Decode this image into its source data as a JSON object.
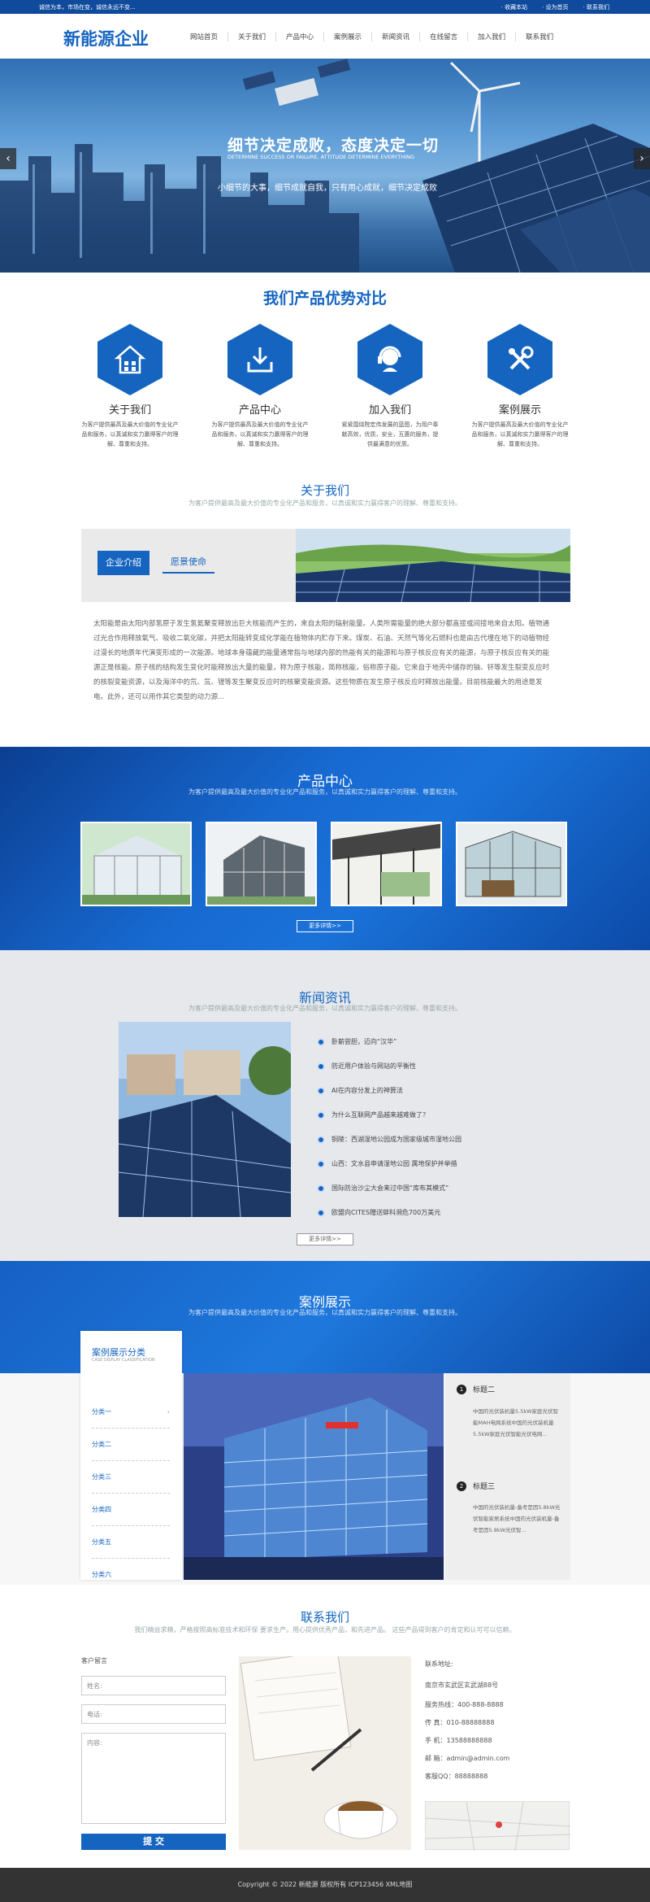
{
  "topbar": {
    "slogan": "诚信为本，市场在变，诚信永远不变...",
    "links": [
      "· 收藏本站",
      "· 设为首页",
      "· 联系我们"
    ]
  },
  "header": {
    "logo": "新能源企业",
    "nav": [
      "网站首页",
      "关于我们",
      "产品中心",
      "案例展示",
      "新闻资讯",
      "在线留言",
      "加入我们",
      "联系我们"
    ]
  },
  "banner": {
    "headline": "细节决定成败，态度决定一切",
    "sub": "DETERMINE SUCCESS OR FAILURE, ATTITUDE DETERMINE EVERYTHING",
    "tagline": "小细节的大事，细节成就自我，只有用心成就，细节决定成败",
    "prev_icon": "chevron-left-icon",
    "next_icon": "chevron-right-icon"
  },
  "advantages": {
    "title": "我们产品优势对比",
    "items": [
      {
        "icon": "building-icon",
        "title": "关于我们",
        "desc": "为客户提供最高及最大价值的专业化产品和服务，以真诚和实力赢得客户的理解、尊重和支持。"
      },
      {
        "icon": "download-icon",
        "title": "产品中心",
        "desc": "为客户提供最高及最大价值的专业化产品和服务，以真诚和实力赢得客户的理解、尊重和支持。"
      },
      {
        "icon": "headset-icon",
        "title": "加入我们",
        "desc": "紧紧围绕院宏伟发展的蓝图，为用户奉献高效，优质，安全，互惠的服务，提供最满意的优质。"
      },
      {
        "icon": "tools-icon",
        "title": "案例展示",
        "desc": "为客户提供最高及最大价值的专业化产品和服务，以真诚和实力赢得客户的理解、尊重和支持。"
      }
    ]
  },
  "about": {
    "title": "关于我们",
    "sub": "为客户提供最高及最大价值的专业化产品和服务，以真诚和实力赢得客户的理解、尊重和支持。",
    "tabs": [
      "企业介绍",
      "愿景使命"
    ],
    "text": "太阳能是由太阳内部氢原子发生氢氦聚变释放出巨大核能而产生的，来自太阳的辐射能量。人类所需能量的绝大部分都直接或间接地来自太阳。植物通过光合作用释放氧气、吸收二氧化碳，并把太阳能转变成化学能在植物体内贮存下来。煤炭、石油、天然气等化石燃料也是由古代埋在地下的动植物经过漫长的地质年代演变形成的一次能源。地球本身蕴藏的能量通常指与地球内部的热能有关的能源和与原子核反应有关的能源，与原子核反应有关的能源正是核能。原子核的结构发生变化时能释放出大量的能量，称为原子核能，简称核能，俗称原子能。它来自于地壳中储存的铀、钚等发生裂变反应时的核裂变能资源，以及海洋中的氘、氚、锂等发生聚变反应时的核聚变能资源。这些物质在发生原子核反应时释放出能量。目前核能最大的用途是发电。此外，还可以用作其它类型的动力源..."
  },
  "product": {
    "title": "产品中心",
    "sub": "为客户提供最高及最大价值的专业化产品和服务，以真诚和实力赢得客户的理解、尊重和支持。",
    "more": "更多详情>>"
  },
  "news": {
    "title": "新闻资讯",
    "sub": "为客户提供最高及最大价值的专业化产品和服务，以真诚和实力赢得客户的理解、尊重和支持。",
    "items": [
      "卧薪尝胆，迈向“汉华”",
      "防近用户体验与网站的平衡性",
      "AI在内容分发上的神算法",
      "为什么互联网产品越来越难做了？",
      "铜陵：西湖湿地公园成为国家级城市湿地公园",
      "山西：文水县申请湿地公园 属地保护并举措",
      "国际防治沙尘大会来过中国“库布其模式”",
      "欧盟向CITES赠送蚌科濒危700万美元"
    ],
    "more": "更多详情>>"
  },
  "cases": {
    "title": "案例展示",
    "sub": "为客户提供最高及最大价值的专业化产品和服务，以真诚和实力赢得客户的理解、尊重和支持。",
    "side_title": "案例展示分类",
    "side_sub": "CASE DISPLAY CLASSIFICATION",
    "categories": [
      "分类一",
      "分类二",
      "分类三",
      "分类四",
      "分类五",
      "分类六"
    ],
    "entries": [
      {
        "num": "1",
        "title": "标题二",
        "desc": "中国的光伏装机量5.5kW家庭光伏智能MAH电网系统中国的光伏装机量5.5kW家庭光伏智能光伏电网..."
      },
      {
        "num": "2",
        "title": "标题三",
        "desc": "中国的光伏装机量-备考是因5.8kW光伏智能家居系统中国的光伏装机量-备考是因5.8kW光伏智..."
      }
    ]
  },
  "contact": {
    "title": "联系我们",
    "sub": "我们精益求精，严格按照高标准技术和环保 要求生产。用心提供优秀产品，和先进产品。 这些产品得到客户的肯定和认可可以信赖。",
    "form_title": "客户留言",
    "name_ph": "姓名:",
    "phone_ph": "电话:",
    "content_ph": "内容:",
    "submit": "提 交",
    "info_title": "联系地址:",
    "address": "南京市玄武区玄武湖88号",
    "lines": [
      "服务热线：400-888-8888",
      "传 真：010-88888888",
      "手 机：13588888888",
      "邮 箱：admin@admin.com",
      "客服QQ：88888888"
    ]
  },
  "footer": {
    "text": "Copyright © 2022 新能源 版权所有   ICP123456   XML地图"
  }
}
